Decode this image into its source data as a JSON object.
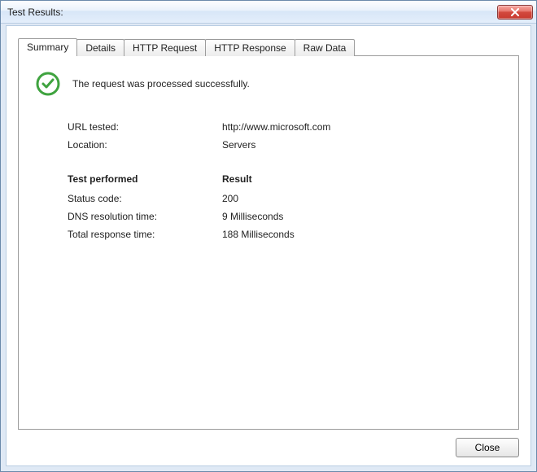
{
  "window": {
    "title": "Test Results:"
  },
  "tabs": [
    {
      "label": "Summary",
      "active": true
    },
    {
      "label": "Details"
    },
    {
      "label": "HTTP Request"
    },
    {
      "label": "HTTP Response"
    },
    {
      "label": "Raw Data"
    }
  ],
  "summary": {
    "status_message": "The request was processed successfully.",
    "url_tested_label": "URL tested:",
    "url_tested_value": "http://www.microsoft.com",
    "location_label": "Location:",
    "location_value": "Servers",
    "test_performed_heading": "Test performed",
    "result_heading": "Result",
    "status_code_label": "Status code:",
    "status_code_value": "200",
    "dns_time_label": "DNS resolution time:",
    "dns_time_value": "9 Milliseconds",
    "total_time_label": "Total response time:",
    "total_time_value": "188 Milliseconds"
  },
  "footer": {
    "close_label": "Close"
  }
}
